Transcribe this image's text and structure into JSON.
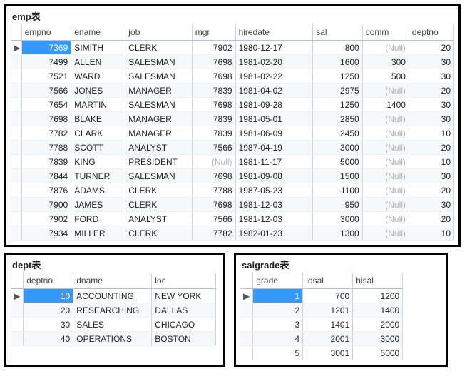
{
  "emp": {
    "title": "emp表",
    "cols": [
      "empno",
      "ename",
      "job",
      "mgr",
      "hiredate",
      "sal",
      "comm",
      "deptno"
    ],
    "rows": [
      {
        "empno": 7369,
        "ename": "SIMITH",
        "job": "CLERK",
        "mgr": 7902,
        "hiredate": "1980-12-17",
        "sal": 800,
        "comm": null,
        "deptno": 20
      },
      {
        "empno": 7499,
        "ename": "ALLEN",
        "job": "SALESMAN",
        "mgr": 7698,
        "hiredate": "1981-02-20",
        "sal": 1600,
        "comm": 300,
        "deptno": 30
      },
      {
        "empno": 7521,
        "ename": "WARD",
        "job": "SALESMAN",
        "mgr": 7698,
        "hiredate": "1981-02-22",
        "sal": 1250,
        "comm": 500,
        "deptno": 30
      },
      {
        "empno": 7566,
        "ename": "JONES",
        "job": "MANAGER",
        "mgr": 7839,
        "hiredate": "1981-04-02",
        "sal": 2975,
        "comm": null,
        "deptno": 20
      },
      {
        "empno": 7654,
        "ename": "MARTIN",
        "job": "SALESMAN",
        "mgr": 7698,
        "hiredate": "1981-09-28",
        "sal": 1250,
        "comm": 1400,
        "deptno": 30
      },
      {
        "empno": 7698,
        "ename": "BLAKE",
        "job": "MANAGER",
        "mgr": 7839,
        "hiredate": "1981-05-01",
        "sal": 2850,
        "comm": null,
        "deptno": 30
      },
      {
        "empno": 7782,
        "ename": "CLARK",
        "job": "MANAGER",
        "mgr": 7839,
        "hiredate": "1981-06-09",
        "sal": 2450,
        "comm": null,
        "deptno": 10
      },
      {
        "empno": 7788,
        "ename": "SCOTT",
        "job": "ANALYST",
        "mgr": 7566,
        "hiredate": "1987-04-19",
        "sal": 3000,
        "comm": null,
        "deptno": 20
      },
      {
        "empno": 7839,
        "ename": "KING",
        "job": "PRESIDENT",
        "mgr": null,
        "hiredate": "1981-11-17",
        "sal": 5000,
        "comm": null,
        "deptno": 10
      },
      {
        "empno": 7844,
        "ename": "TURNER",
        "job": "SALESMAN",
        "mgr": 7698,
        "hiredate": "1981-09-08",
        "sal": 1500,
        "comm": null,
        "deptno": 30
      },
      {
        "empno": 7876,
        "ename": "ADAMS",
        "job": "CLERK",
        "mgr": 7788,
        "hiredate": "1987-05-23",
        "sal": 1100,
        "comm": null,
        "deptno": 20
      },
      {
        "empno": 7900,
        "ename": "JAMES",
        "job": "CLERK",
        "mgr": 7698,
        "hiredate": "1981-12-03",
        "sal": 950,
        "comm": null,
        "deptno": 30
      },
      {
        "empno": 7902,
        "ename": "FORD",
        "job": "ANALYST",
        "mgr": 7566,
        "hiredate": "1981-12-03",
        "sal": 3000,
        "comm": null,
        "deptno": 20
      },
      {
        "empno": 7934,
        "ename": "MILLER",
        "job": "CLERK",
        "mgr": 7782,
        "hiredate": "1982-01-23",
        "sal": 1300,
        "comm": null,
        "deptno": 10
      }
    ],
    "selected_index": 0
  },
  "dept": {
    "title": "dept表",
    "cols": [
      "deptno",
      "dname",
      "loc"
    ],
    "rows": [
      {
        "deptno": 10,
        "dname": "ACCOUNTING",
        "loc": "NEW YORK"
      },
      {
        "deptno": 20,
        "dname": "RESEARCHING",
        "loc": "DALLAS"
      },
      {
        "deptno": 30,
        "dname": "SALES",
        "loc": "CHICAGO"
      },
      {
        "deptno": 40,
        "dname": "OPERATIONS",
        "loc": "BOSTON"
      }
    ],
    "selected_index": 0
  },
  "salgrade": {
    "title": "salgrade表",
    "cols": [
      "grade",
      "losal",
      "hisal"
    ],
    "rows": [
      {
        "grade": 1,
        "losal": 700,
        "hisal": 1200
      },
      {
        "grade": 2,
        "losal": 1201,
        "hisal": 1400
      },
      {
        "grade": 3,
        "losal": 1401,
        "hisal": 2000
      },
      {
        "grade": 4,
        "losal": 2001,
        "hisal": 3000
      },
      {
        "grade": 5,
        "losal": 3001,
        "hisal": 5000
      }
    ],
    "selected_index": 0
  },
  "null_label": "(Null)",
  "indicator": "▶"
}
